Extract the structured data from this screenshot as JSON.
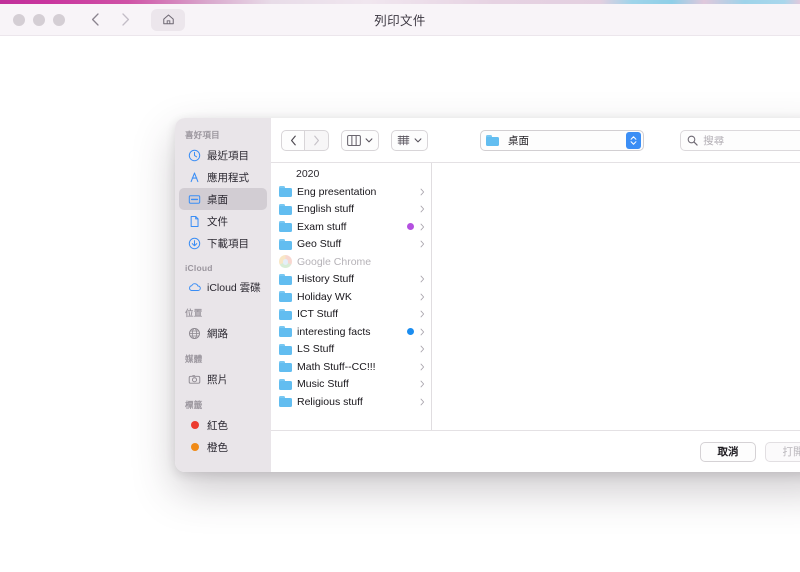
{
  "browser": {
    "window_title": "列印文件",
    "traffic_lights": [
      "close",
      "minimize",
      "zoom"
    ],
    "back_label": "上一頁",
    "forward_label": "下一頁",
    "home_label": "首頁",
    "accent_colors": {
      "magenta": "#c0309a",
      "pink": "#e3cfe0",
      "cyan": "#9fd4ea",
      "chrome_bg": "#f8f4f8"
    }
  },
  "dialog": {
    "toolbar": {
      "back": "‹",
      "forward": "›",
      "view_mode": "column-view",
      "arrange": "arrange-by",
      "path_label": "桌面",
      "search_placeholder": "搜尋"
    },
    "sidebar": {
      "groups": [
        {
          "title": "喜好項目",
          "items": [
            {
              "label": "最近項目",
              "icon": "clock-icon",
              "selected": false
            },
            {
              "label": "應用程式",
              "icon": "applications-icon",
              "selected": false
            },
            {
              "label": "桌面",
              "icon": "desktop-icon",
              "selected": true
            },
            {
              "label": "文件",
              "icon": "document-icon",
              "selected": false
            },
            {
              "label": "下載項目",
              "icon": "downloads-icon",
              "selected": false
            }
          ]
        },
        {
          "title": "iCloud",
          "items": [
            {
              "label": "iCloud 雲碟",
              "icon": "cloud-icon",
              "selected": false
            }
          ]
        },
        {
          "title": "位置",
          "items": [
            {
              "label": "網路",
              "icon": "network-globe-icon",
              "selected": false
            }
          ]
        },
        {
          "title": "媒體",
          "items": [
            {
              "label": "照片",
              "icon": "photos-camera-icon",
              "selected": false
            }
          ]
        },
        {
          "title": "標籤",
          "items": [
            {
              "label": "紅色",
              "icon": "tag-dot-icon",
              "color": "#ec3b2e",
              "selected": false
            },
            {
              "label": "橙色",
              "icon": "tag-dot-icon",
              "color": "#f08a16",
              "selected": false
            }
          ]
        }
      ]
    },
    "files": [
      {
        "name": "2020",
        "icon": "none",
        "tag": null,
        "chevron": false,
        "dimmed": false
      },
      {
        "name": "Eng presentation",
        "icon": "folder-icon",
        "tag": null,
        "chevron": true,
        "dimmed": false
      },
      {
        "name": "English stuff",
        "icon": "folder-icon",
        "tag": null,
        "chevron": true,
        "dimmed": false
      },
      {
        "name": "Exam stuff",
        "icon": "folder-icon",
        "tag": "#b450e0",
        "chevron": true,
        "dimmed": false
      },
      {
        "name": "Geo Stuff",
        "icon": "folder-icon",
        "tag": null,
        "chevron": true,
        "dimmed": false
      },
      {
        "name": "Google Chrome",
        "icon": "chrome-icon",
        "tag": null,
        "chevron": false,
        "dimmed": true
      },
      {
        "name": "History Stuff",
        "icon": "folder-icon",
        "tag": null,
        "chevron": true,
        "dimmed": false
      },
      {
        "name": "Holiday WK",
        "icon": "folder-icon",
        "tag": null,
        "chevron": true,
        "dimmed": false
      },
      {
        "name": "ICT Stuff",
        "icon": "folder-icon",
        "tag": null,
        "chevron": true,
        "dimmed": false
      },
      {
        "name": "interesting facts",
        "icon": "folder-icon",
        "tag": "#1b8df0",
        "chevron": true,
        "dimmed": false
      },
      {
        "name": "LS Stuff",
        "icon": "folder-icon",
        "tag": null,
        "chevron": true,
        "dimmed": false
      },
      {
        "name": "Math Stuff--CC!!!",
        "icon": "folder-icon",
        "tag": null,
        "chevron": true,
        "dimmed": false
      },
      {
        "name": "Music Stuff",
        "icon": "folder-icon",
        "tag": null,
        "chevron": true,
        "dimmed": false
      },
      {
        "name": "Religious stuff",
        "icon": "folder-icon",
        "tag": null,
        "chevron": true,
        "dimmed": false
      }
    ],
    "footer": {
      "cancel_label": "取消",
      "open_label": "打開",
      "open_disabled": true
    }
  }
}
